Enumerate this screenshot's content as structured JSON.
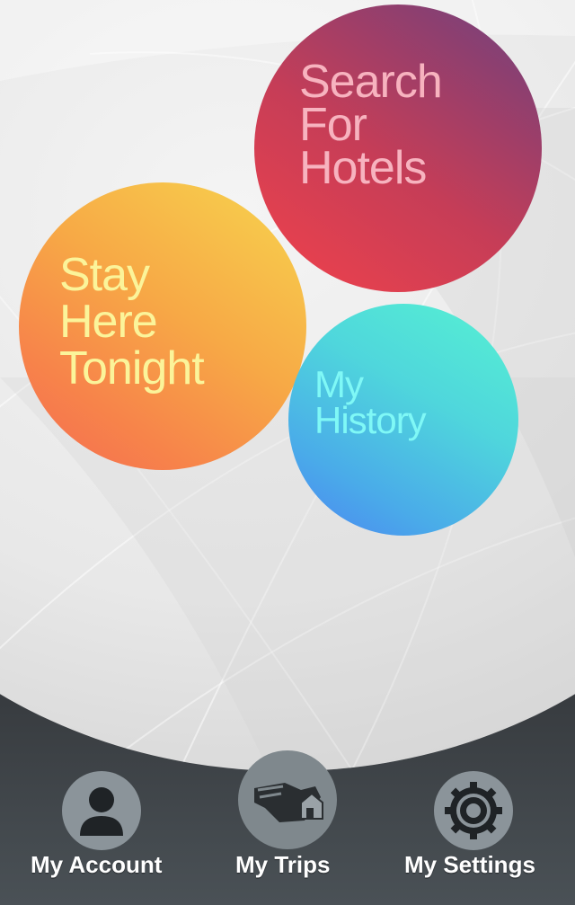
{
  "bubbles": {
    "search": {
      "label": "Search\nFor\nHotels",
      "color": "#c63d57"
    },
    "stay": {
      "label": "Stay\nHere\nTonight",
      "color": "#f7a946"
    },
    "history": {
      "label": "My\nHistory",
      "color": "#4fd6dc"
    }
  },
  "tabbar": {
    "account": {
      "label": "My Account",
      "icon": "person-icon"
    },
    "trips": {
      "label": "My Trips",
      "icon": "hand-house-icon"
    },
    "settings": {
      "label": "My Settings",
      "icon": "gear-icon"
    }
  }
}
